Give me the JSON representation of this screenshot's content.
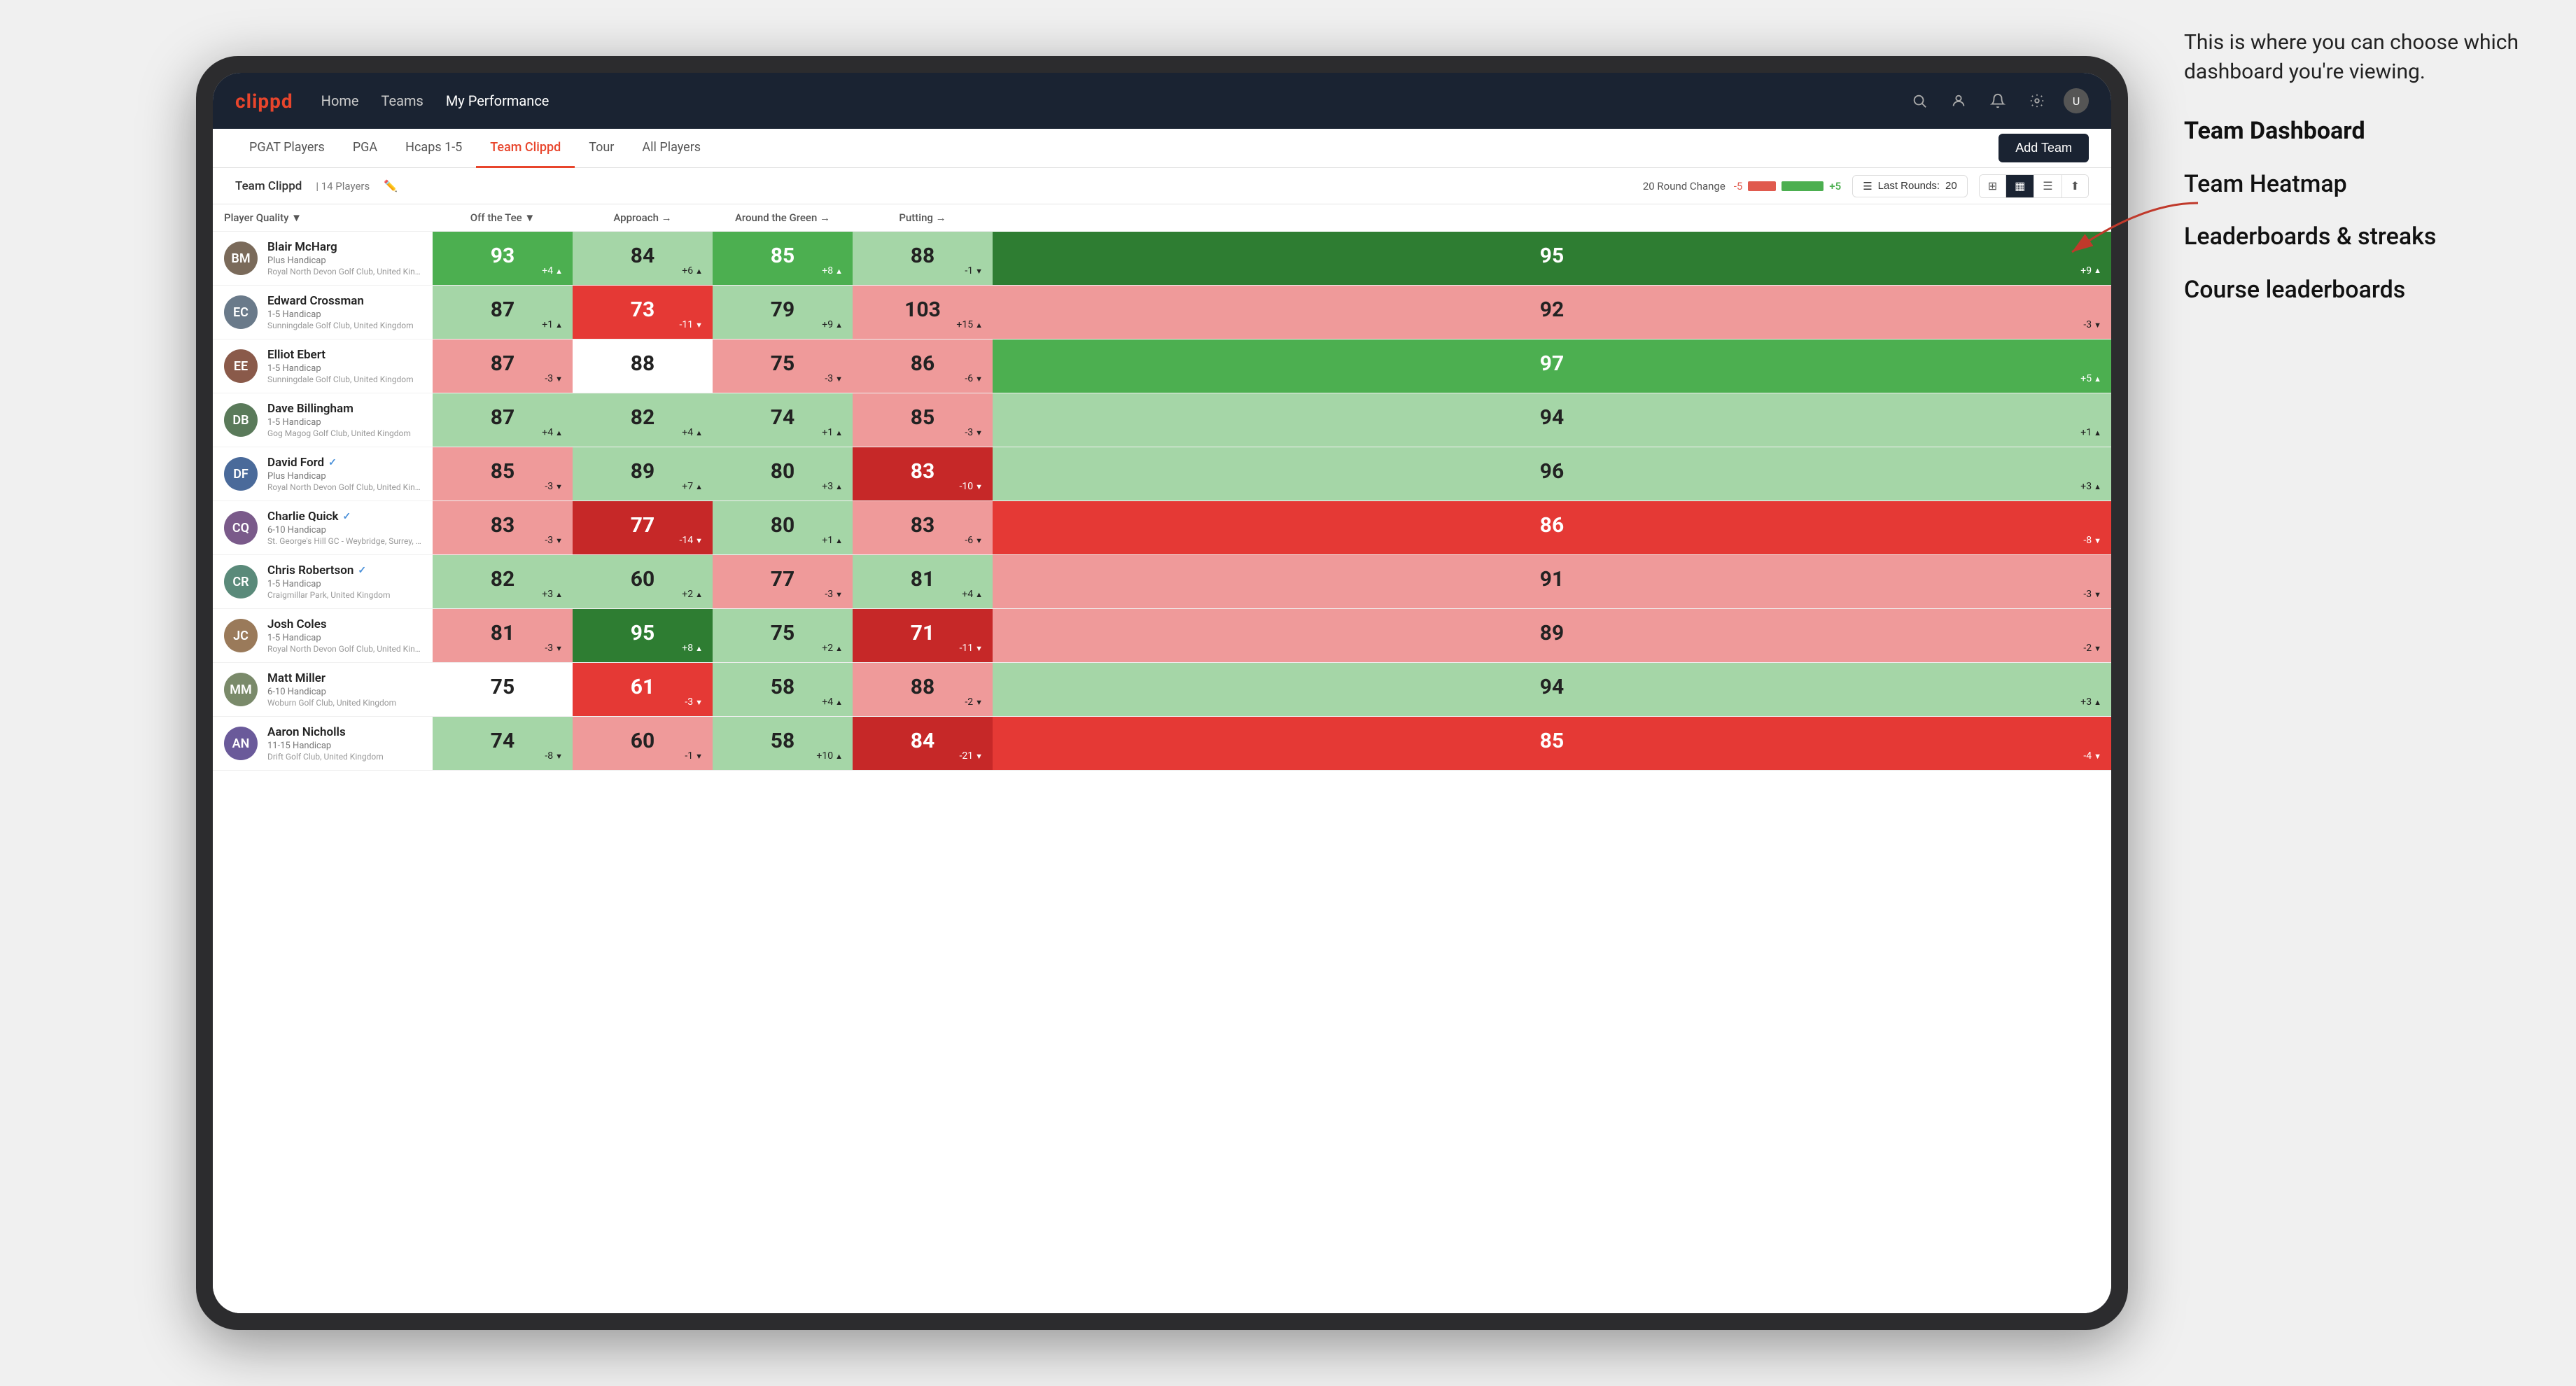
{
  "annotation": {
    "intro": "This is where you can choose which dashboard you're viewing.",
    "items": [
      {
        "label": "Team Dashboard",
        "active": true
      },
      {
        "label": "Team Heatmap",
        "active": false
      },
      {
        "label": "Leaderboards & streaks",
        "active": false
      },
      {
        "label": "Course leaderboards",
        "active": false
      }
    ]
  },
  "navbar": {
    "brand": "clippd",
    "nav_items": [
      {
        "label": "Home",
        "active": false
      },
      {
        "label": "Teams",
        "active": false
      },
      {
        "label": "My Performance",
        "active": true
      }
    ],
    "icons": [
      "search",
      "person",
      "bell",
      "settings",
      "avatar"
    ]
  },
  "subnav": {
    "items": [
      {
        "label": "PGAT Players",
        "active": false
      },
      {
        "label": "PGA",
        "active": false
      },
      {
        "label": "Hcaps 1-5",
        "active": false
      },
      {
        "label": "Team Clippd",
        "active": true
      },
      {
        "label": "Tour",
        "active": false
      },
      {
        "label": "All Players",
        "active": false
      }
    ],
    "add_team_label": "Add Team"
  },
  "toolbar": {
    "team_name": "Team Clippd",
    "player_count": "14 Players",
    "round_change_label": "20 Round Change",
    "change_value": "-5",
    "plus_value": "+5",
    "last_rounds_label": "Last Rounds:",
    "last_rounds_value": "20"
  },
  "table": {
    "columns": [
      {
        "label": "Player Quality ▼",
        "key": "quality"
      },
      {
        "label": "Off the Tee ▼",
        "key": "tee"
      },
      {
        "label": "Approach →",
        "key": "approach"
      },
      {
        "label": "Around the Green →",
        "key": "around"
      },
      {
        "label": "Putting →",
        "key": "putting"
      }
    ],
    "rows": [
      {
        "name": "Blair McHarg",
        "handicap": "Plus Handicap",
        "club": "Royal North Devon Golf Club, United Kingdom",
        "initials": "BM",
        "avatar_color": "#7a6a5a",
        "verified": false,
        "quality": {
          "value": 93,
          "change": "+4",
          "dir": "up",
          "color": "green-mid"
        },
        "tee": {
          "value": 84,
          "change": "+6",
          "dir": "up",
          "color": "green-light"
        },
        "approach": {
          "value": 85,
          "change": "+8",
          "dir": "up",
          "color": "green-mid"
        },
        "around": {
          "value": 88,
          "change": "-1",
          "dir": "down",
          "color": "green-light"
        },
        "putting": {
          "value": 95,
          "change": "+9",
          "dir": "up",
          "color": "green-dark"
        }
      },
      {
        "name": "Edward Crossman",
        "handicap": "1-5 Handicap",
        "club": "Sunningdale Golf Club, United Kingdom",
        "initials": "EC",
        "avatar_color": "#6a7a8a",
        "verified": false,
        "quality": {
          "value": 87,
          "change": "+1",
          "dir": "up",
          "color": "green-light"
        },
        "tee": {
          "value": 73,
          "change": "-11",
          "dir": "down",
          "color": "red-mid"
        },
        "approach": {
          "value": 79,
          "change": "+9",
          "dir": "up",
          "color": "green-light"
        },
        "around": {
          "value": 103,
          "change": "+15",
          "dir": "up",
          "color": "red-light"
        },
        "putting": {
          "value": 92,
          "change": "-3",
          "dir": "down",
          "color": "red-light"
        }
      },
      {
        "name": "Elliot Ebert",
        "handicap": "1-5 Handicap",
        "club": "Sunningdale Golf Club, United Kingdom",
        "initials": "EE",
        "avatar_color": "#8a5a4a",
        "verified": false,
        "quality": {
          "value": 87,
          "change": "-3",
          "dir": "down",
          "color": "red-light"
        },
        "tee": {
          "value": 88,
          "change": "",
          "dir": "none",
          "color": "neutral"
        },
        "approach": {
          "value": 75,
          "change": "-3",
          "dir": "down",
          "color": "red-light"
        },
        "around": {
          "value": 86,
          "change": "-6",
          "dir": "down",
          "color": "red-light"
        },
        "putting": {
          "value": 97,
          "change": "+5",
          "dir": "up",
          "color": "green-mid"
        }
      },
      {
        "name": "Dave Billingham",
        "handicap": "1-5 Handicap",
        "club": "Gog Magog Golf Club, United Kingdom",
        "initials": "DB",
        "avatar_color": "#5a7a5a",
        "verified": false,
        "quality": {
          "value": 87,
          "change": "+4",
          "dir": "up",
          "color": "green-light"
        },
        "tee": {
          "value": 82,
          "change": "+4",
          "dir": "up",
          "color": "green-light"
        },
        "approach": {
          "value": 74,
          "change": "+1",
          "dir": "up",
          "color": "green-light"
        },
        "around": {
          "value": 85,
          "change": "-3",
          "dir": "down",
          "color": "red-light"
        },
        "putting": {
          "value": 94,
          "change": "+1",
          "dir": "up",
          "color": "green-light"
        }
      },
      {
        "name": "David Ford",
        "handicap": "Plus Handicap",
        "club": "Royal North Devon Golf Club, United Kingdom",
        "initials": "DF",
        "avatar_color": "#4a6a9a",
        "verified": true,
        "quality": {
          "value": 85,
          "change": "-3",
          "dir": "down",
          "color": "red-light"
        },
        "tee": {
          "value": 89,
          "change": "+7",
          "dir": "up",
          "color": "green-light"
        },
        "approach": {
          "value": 80,
          "change": "+3",
          "dir": "up",
          "color": "green-light"
        },
        "around": {
          "value": 83,
          "change": "-10",
          "dir": "down",
          "color": "red-dark"
        },
        "putting": {
          "value": 96,
          "change": "+3",
          "dir": "up",
          "color": "green-light"
        }
      },
      {
        "name": "Charlie Quick",
        "handicap": "6-10 Handicap",
        "club": "St. George's Hill GC - Weybridge, Surrey, Uni...",
        "initials": "CQ",
        "avatar_color": "#7a5a8a",
        "verified": true,
        "quality": {
          "value": 83,
          "change": "-3",
          "dir": "down",
          "color": "red-light"
        },
        "tee": {
          "value": 77,
          "change": "-14",
          "dir": "down",
          "color": "red-dark"
        },
        "approach": {
          "value": 80,
          "change": "+1",
          "dir": "up",
          "color": "green-light"
        },
        "around": {
          "value": 83,
          "change": "-6",
          "dir": "down",
          "color": "red-light"
        },
        "putting": {
          "value": 86,
          "change": "-8",
          "dir": "down",
          "color": "red-mid"
        }
      },
      {
        "name": "Chris Robertson",
        "handicap": "1-5 Handicap",
        "club": "Craigmillar Park, United Kingdom",
        "initials": "CR",
        "avatar_color": "#5a8a7a",
        "verified": true,
        "quality": {
          "value": 82,
          "change": "+3",
          "dir": "up",
          "color": "green-light"
        },
        "tee": {
          "value": 60,
          "change": "+2",
          "dir": "up",
          "color": "green-light"
        },
        "approach": {
          "value": 77,
          "change": "-3",
          "dir": "down",
          "color": "red-light"
        },
        "around": {
          "value": 81,
          "change": "+4",
          "dir": "up",
          "color": "green-light"
        },
        "putting": {
          "value": 91,
          "change": "-3",
          "dir": "down",
          "color": "red-light"
        }
      },
      {
        "name": "Josh Coles",
        "handicap": "1-5 Handicap",
        "club": "Royal North Devon Golf Club, United Kingdom",
        "initials": "JC",
        "avatar_color": "#9a7a5a",
        "verified": false,
        "quality": {
          "value": 81,
          "change": "-3",
          "dir": "down",
          "color": "red-light"
        },
        "tee": {
          "value": 95,
          "change": "+8",
          "dir": "up",
          "color": "green-dark"
        },
        "approach": {
          "value": 75,
          "change": "+2",
          "dir": "up",
          "color": "green-light"
        },
        "around": {
          "value": 71,
          "change": "-11",
          "dir": "down",
          "color": "red-dark"
        },
        "putting": {
          "value": 89,
          "change": "-2",
          "dir": "down",
          "color": "red-light"
        }
      },
      {
        "name": "Matt Miller",
        "handicap": "6-10 Handicap",
        "club": "Woburn Golf Club, United Kingdom",
        "initials": "MM",
        "avatar_color": "#7a8a6a",
        "verified": false,
        "quality": {
          "value": 75,
          "change": "",
          "dir": "none",
          "color": "neutral"
        },
        "tee": {
          "value": 61,
          "change": "-3",
          "dir": "down",
          "color": "red-mid"
        },
        "approach": {
          "value": 58,
          "change": "+4",
          "dir": "up",
          "color": "green-light"
        },
        "around": {
          "value": 88,
          "change": "-2",
          "dir": "down",
          "color": "red-light"
        },
        "putting": {
          "value": 94,
          "change": "+3",
          "dir": "up",
          "color": "green-light"
        }
      },
      {
        "name": "Aaron Nicholls",
        "handicap": "11-15 Handicap",
        "club": "Drift Golf Club, United Kingdom",
        "initials": "AN",
        "avatar_color": "#6a5a9a",
        "verified": false,
        "quality": {
          "value": 74,
          "change": "-8",
          "dir": "down",
          "color": "green-light"
        },
        "tee": {
          "value": 60,
          "change": "-1",
          "dir": "down",
          "color": "red-light"
        },
        "approach": {
          "value": 58,
          "change": "+10",
          "dir": "up",
          "color": "green-light"
        },
        "around": {
          "value": 84,
          "change": "-21",
          "dir": "down",
          "color": "red-dark"
        },
        "putting": {
          "value": 85,
          "change": "-4",
          "dir": "down",
          "color": "red-mid"
        }
      }
    ]
  }
}
